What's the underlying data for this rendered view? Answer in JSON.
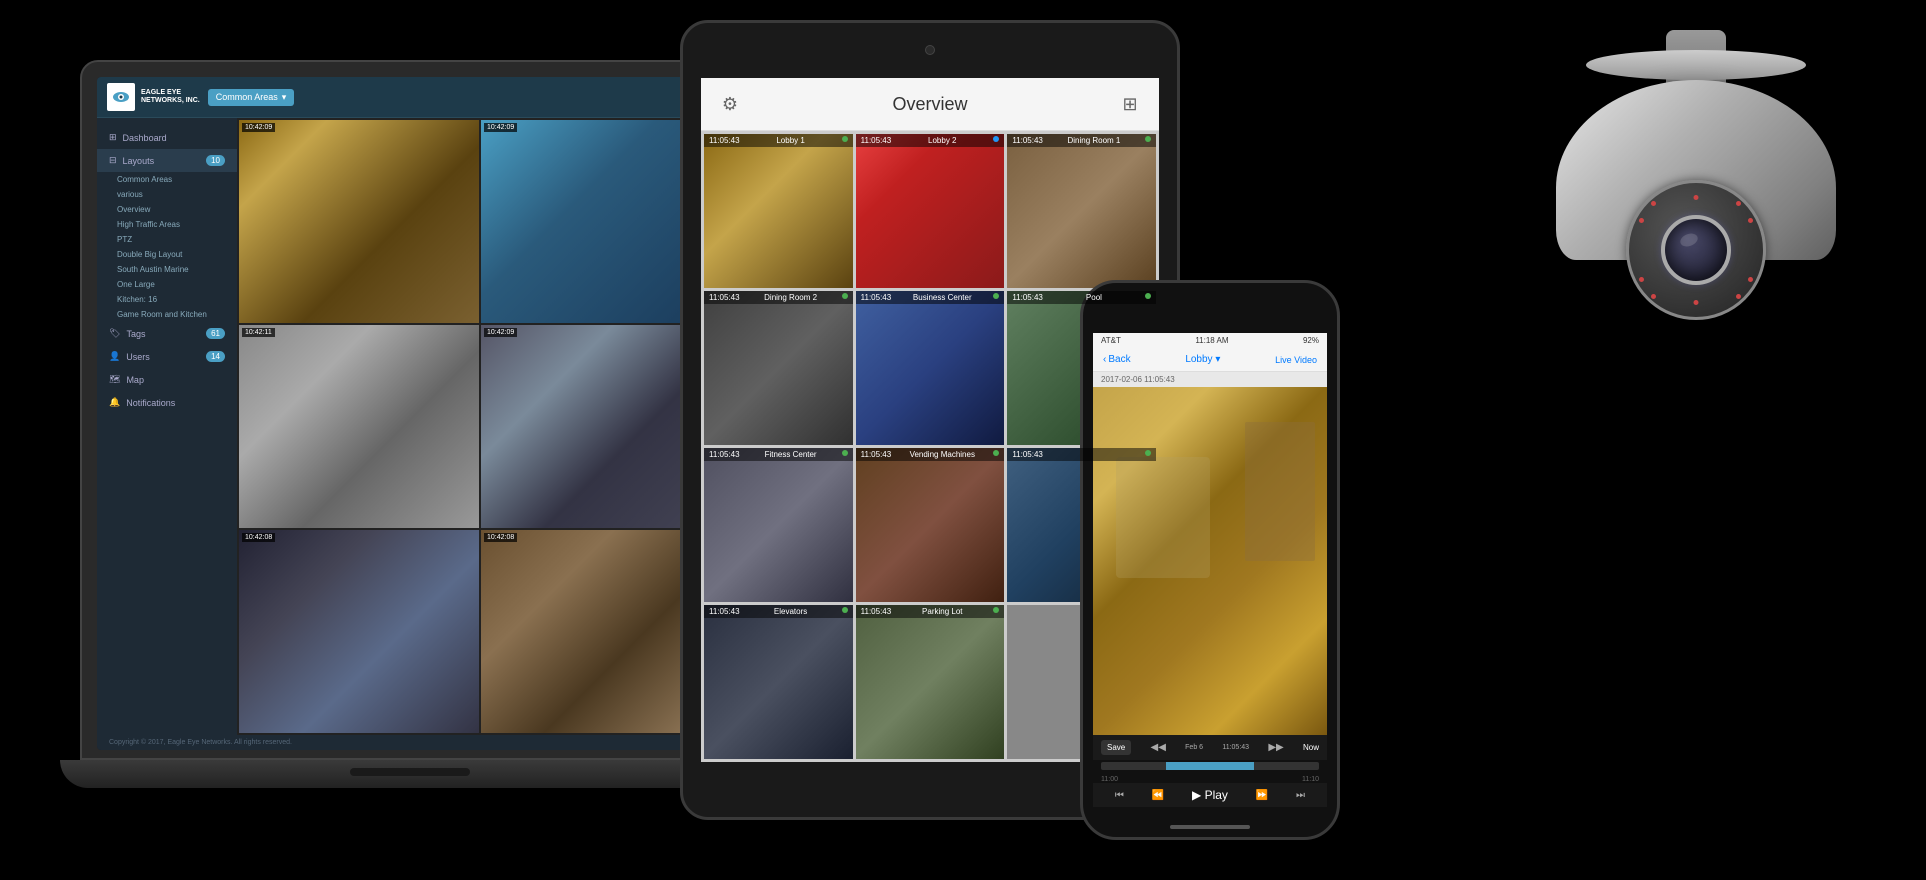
{
  "app": {
    "title": "Eagle Eye Networks",
    "location_badge": "Common Areas",
    "header": {
      "logo_text": "EAGLE EYE\nNETWORKS, INC."
    }
  },
  "sidebar": {
    "dashboard_label": "Dashboard",
    "layouts_label": "Layouts",
    "layouts_badge": "10",
    "tags_label": "Tags",
    "tags_badge": "61",
    "users_label": "Users",
    "users_badge": "14",
    "map_label": "Map",
    "notifications_label": "Notifications",
    "layout_items": [
      "Common Areas",
      "various",
      "Overview",
      "High Traffic Areas",
      "PTZ",
      "Double Big Layout",
      "South Austin Marine",
      "One Large",
      "Kitchen: 16",
      "Game Room and Kitchen"
    ]
  },
  "laptop_cameras": [
    {
      "timestamp": "10:42:09",
      "class": "cam1"
    },
    {
      "timestamp": "10:42:09",
      "class": "cam2"
    },
    {
      "timestamp": "10:42:11",
      "class": "cam3"
    },
    {
      "timestamp": "10:42:09",
      "class": "cam4"
    },
    {
      "timestamp": "10:42:08",
      "class": "cam5"
    },
    {
      "timestamp": "10:42:08",
      "class": "cam6"
    }
  ],
  "copyright": "Copyright © 2017, Eagle Eye Networks.\nAll rights reserved.",
  "tablet": {
    "title": "Overview",
    "cameras": [
      {
        "time": "11:05:43",
        "name": "Lobby 1",
        "indicator": "green",
        "class": "tcam1"
      },
      {
        "time": "11:05:43",
        "name": "Lobby 2",
        "indicator": "blue",
        "class": "tcam2"
      },
      {
        "time": "11:05:43",
        "name": "Dining Room 1",
        "indicator": "green",
        "class": "tcam3"
      },
      {
        "time": "11:05:43",
        "name": "Dining Room 2",
        "indicator": "green",
        "class": "tcam4"
      },
      {
        "time": "11:05:43",
        "name": "Business Center",
        "indicator": "green",
        "class": "tcam5"
      },
      {
        "time": "11:05:43",
        "name": "Pool",
        "indicator": "green",
        "class": "tcam6"
      },
      {
        "time": "11:05:43",
        "name": "Fitness Center",
        "indicator": "green",
        "class": "tcam7"
      },
      {
        "time": "11:05:43",
        "name": "Vending Machines",
        "indicator": "green",
        "class": "tcam8"
      },
      {
        "time": "11:05:43",
        "name": "",
        "indicator": "green",
        "class": "tcam9"
      },
      {
        "time": "11:05:43",
        "name": "Elevators",
        "indicator": "green",
        "class": "tcam10"
      },
      {
        "time": "11:05:43",
        "name": "Parking Lot",
        "indicator": "green",
        "class": "tcam11"
      }
    ]
  },
  "phone": {
    "carrier": "AT&T",
    "time": "11:18 AM",
    "battery": "92%",
    "back_label": "Back",
    "location_label": "Lobby",
    "live_label": "Live Video",
    "date_label": "2017-02-06 11:05:43",
    "save_label": "Save",
    "date_short": "Feb 6",
    "timestamp": "11:05:43",
    "now_label": "Now",
    "time_11": "11:00",
    "time_1110": "11:10",
    "playback_controls": [
      "⏮",
      "⏪",
      "Play",
      "⏩",
      "⏭"
    ]
  }
}
